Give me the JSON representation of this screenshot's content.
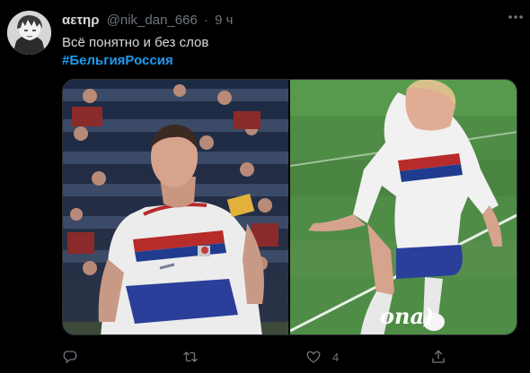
{
  "tweet": {
    "display_name": "αετηρ",
    "handle": "@nik_dan_666",
    "separator": "·",
    "time": "9 ч",
    "text": "Всё понятно и без слов",
    "hashtag": "#БельгияРоссия",
    "media_caption": "ona)",
    "likes": "4"
  },
  "icons": {
    "more": "more-icon",
    "reply": "reply-icon",
    "retweet": "retweet-icon",
    "like": "heart-icon",
    "share": "share-icon"
  },
  "colors": {
    "background": "#000000",
    "text": "#d9d9d9",
    "muted": "#6e767d",
    "hashtag": "#1d9bf0"
  }
}
